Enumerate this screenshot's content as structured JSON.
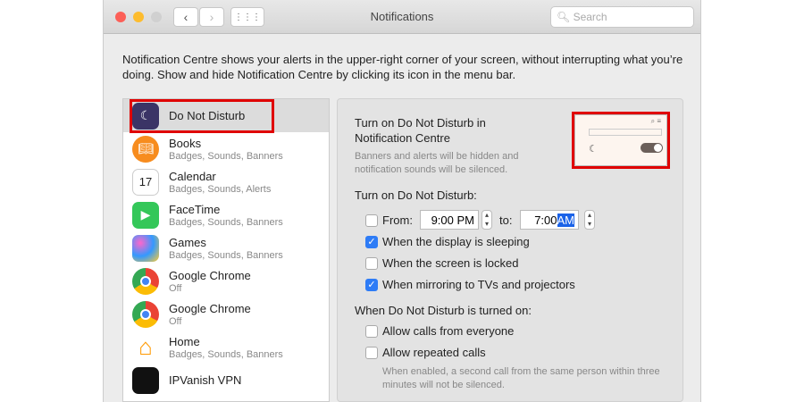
{
  "window": {
    "title": "Notifications",
    "search_placeholder": "Search"
  },
  "intro": "Notification Centre shows your alerts in the upper-right corner of your screen, without interrupting what you’re doing. Show and hide Notification Centre by clicking its icon in the menu bar.",
  "apps": [
    {
      "name": "Do Not Disturb",
      "sub": ""
    },
    {
      "name": "Books",
      "sub": "Badges, Sounds, Banners"
    },
    {
      "name": "Calendar",
      "sub": "Badges, Sounds, Alerts"
    },
    {
      "name": "FaceTime",
      "sub": "Badges, Sounds, Banners"
    },
    {
      "name": "Games",
      "sub": "Badges, Sounds, Banners"
    },
    {
      "name": "Google Chrome",
      "sub": "Off"
    },
    {
      "name": "Google Chrome",
      "sub": "Off"
    },
    {
      "name": "Home",
      "sub": "Badges, Sounds, Banners"
    },
    {
      "name": "IPVanish VPN",
      "sub": ""
    }
  ],
  "dnd": {
    "heading": "Turn on Do Not Disturb in Notification Centre",
    "desc": "Banners and alerts will be hidden and notification sounds will be silenced.",
    "schedule_label": "Turn on Do Not Disturb:",
    "from_label": "From:",
    "from_value": "9:00 PM",
    "to_label": "to:",
    "to_time": "7:00",
    "to_ampm": "AM",
    "opt_sleep": "When the display is sleeping",
    "opt_locked": "When the screen is locked",
    "opt_mirror": "When mirroring to TVs and projectors",
    "when_on_label": "When Do Not Disturb is turned on:",
    "allow_calls": "Allow calls from everyone",
    "allow_repeated": "Allow repeated calls",
    "repeated_note": "When enabled, a second call from the same person within three minutes will not be silenced."
  }
}
